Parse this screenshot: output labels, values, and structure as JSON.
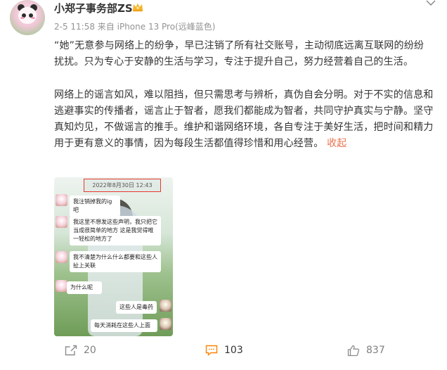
{
  "user": {
    "name": "小郑子事务部ZS",
    "meta": "2-5 11:58  来自 iPhone 13 Pro(远峰蓝色)"
  },
  "post": {
    "paragraph1": "“她”无意参与网络上的纷争，早已注销了所有社交账号，主动彻底远离互联网的纷纷扰扰。只为专心于安静的生活与学习，专注于提升自己，努力经营着自己的生活。",
    "paragraph2": "网络上的谣言如风，难以阻挡，但只需思考与辨析，真伪自会分明。对于不实的信息和逃避事实的传播者，谣言止于智者，愿我们都能成为智者，共同守护真实与宁静。坚守真知灼见，不做谣言的推手。维护和谐网络环境，各自专注于美好生活，把时间和精力用于更有意义的事情，因为每段生活都值得珍惜和用心经营。",
    "collapse_label": "收起"
  },
  "chat": {
    "date": "2022年8月30日 12:43",
    "messages": [
      {
        "side": "left",
        "text": "我注销掉我的ig吧"
      },
      {
        "side": "left",
        "text": "我这里不想发这些声明，我只把它当成很简单的地方 这是我觉得唯一轻松的地方了"
      },
      {
        "side": "left",
        "text": "我不清楚为什么什么都要和这些人扯上关联"
      },
      {
        "side": "left",
        "text": "为什么呢"
      },
      {
        "side": "right",
        "text": "这些人是毒药"
      },
      {
        "side": "right",
        "text": "每天消耗在这些人上面"
      }
    ]
  },
  "actions": {
    "repost_count": "20",
    "comment_count": "103",
    "like_count": "837"
  },
  "colors": {
    "accent": "#eb7350",
    "comment_active": "#ff8200",
    "date_box_border": "#e53b2e"
  },
  "icons": [
    "vip-crown-icon",
    "more-menu-icon",
    "repost-icon",
    "comment-icon",
    "like-icon"
  ]
}
